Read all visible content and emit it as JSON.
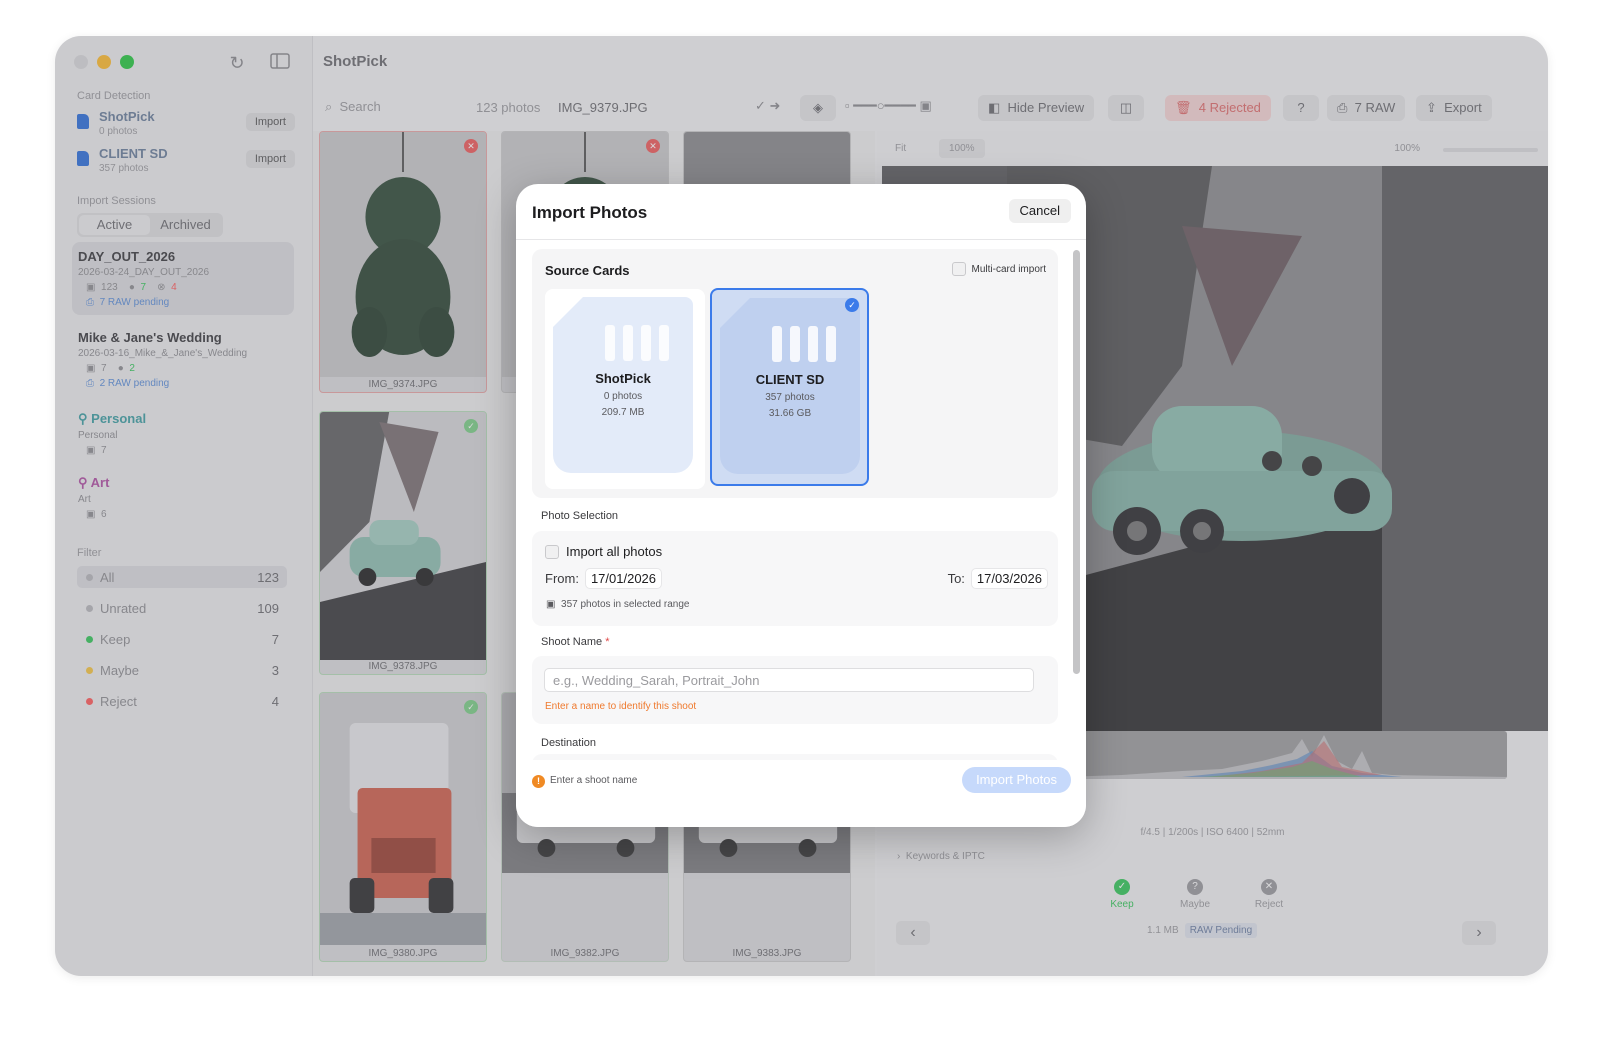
{
  "app": {
    "title": "ShotPick"
  },
  "sidebar": {
    "card_detection_title": "Card Detection",
    "cards": [
      {
        "name": "ShotPick",
        "count": "0 photos",
        "import": "Import"
      },
      {
        "name": "CLIENT SD",
        "count": "357 photos",
        "import": "Import"
      }
    ],
    "sessions_title": "Import Sessions",
    "tabs": {
      "active": "Active",
      "archived": "Archived"
    },
    "sessions": [
      {
        "title": "DAY_OUT_2026",
        "path": "2026-03-24_DAY_OUT_2026",
        "photos": "123",
        "keep": "7",
        "reject": "4",
        "raw": "7 RAW pending"
      },
      {
        "title": "Mike & Jane's Wedding",
        "path": "2026-03-16_Mike_&_Jane's_Wedding",
        "photos": "7",
        "keep": "2",
        "raw": "2 RAW pending"
      },
      {
        "title": "Personal",
        "path": "Personal",
        "photos": "7"
      },
      {
        "title": "Art",
        "path": "Art",
        "photos": "6"
      }
    ],
    "filter_title": "Filter",
    "filters": [
      {
        "label": "All",
        "count": "123",
        "color": "#b8b8bc"
      },
      {
        "label": "Unrated",
        "count": "109",
        "color": "#b8b8bc"
      },
      {
        "label": "Keep",
        "count": "7",
        "color": "#34c759"
      },
      {
        "label": "Maybe",
        "count": "3",
        "color": "#f5c542"
      },
      {
        "label": "Reject",
        "count": "4",
        "color": "#ff5a5a"
      }
    ]
  },
  "toolbar": {
    "search_placeholder": "Search",
    "photo_count": "123 photos",
    "current_file": "IMG_9379.JPG",
    "hide_preview": "Hide Preview",
    "rejected": "4 Rejected",
    "raw": "7 RAW",
    "export": "Export"
  },
  "grid": {
    "thumbs": [
      {
        "name": "IMG_9374.JPG",
        "status": "reject"
      },
      {
        "name": "IMG_9378.JPG",
        "status": "keep"
      },
      {
        "name": "IMG_9380.JPG",
        "status": "keep"
      },
      {
        "name": "IMG_9382.JPG",
        "status": "none"
      },
      {
        "name": "IMG_9383.JPG",
        "status": "none"
      }
    ]
  },
  "preview": {
    "fit": "Fit",
    "zoom": "100%",
    "zoom_right": "100%",
    "exif": "f/4.5 | 1/200s | ISO 6400 | 52mm",
    "keywords": "Keywords & IPTC",
    "keep": "Keep",
    "maybe": "Maybe",
    "reject": "Reject",
    "size": "1.1 MB",
    "raw_status": "RAW Pending"
  },
  "modal": {
    "title": "Import Photos",
    "cancel": "Cancel",
    "source_cards_title": "Source Cards",
    "multi_card": "Multi-card import",
    "cards": [
      {
        "name": "ShotPick",
        "photos": "0 photos",
        "size": "209.7 MB",
        "selected": false
      },
      {
        "name": "CLIENT SD",
        "photos": "357 photos",
        "size": "31.66 GB",
        "selected": true
      }
    ],
    "photo_selection_title": "Photo Selection",
    "import_all": "Import all photos",
    "from_label": "From:",
    "from_date": "17/01/2026",
    "to_label": "To:",
    "to_date": "17/03/2026",
    "range_info": "357 photos in selected range",
    "shoot_name_label": "Shoot Name",
    "required_mark": "*",
    "shoot_name_placeholder": "e.g., Wedding_Sarah, Portrait_John",
    "shoot_name_error": "Enter a name to identify this shoot",
    "destination_label": "Destination",
    "footer_warning": "Enter a shoot name",
    "import_button": "Import Photos"
  }
}
